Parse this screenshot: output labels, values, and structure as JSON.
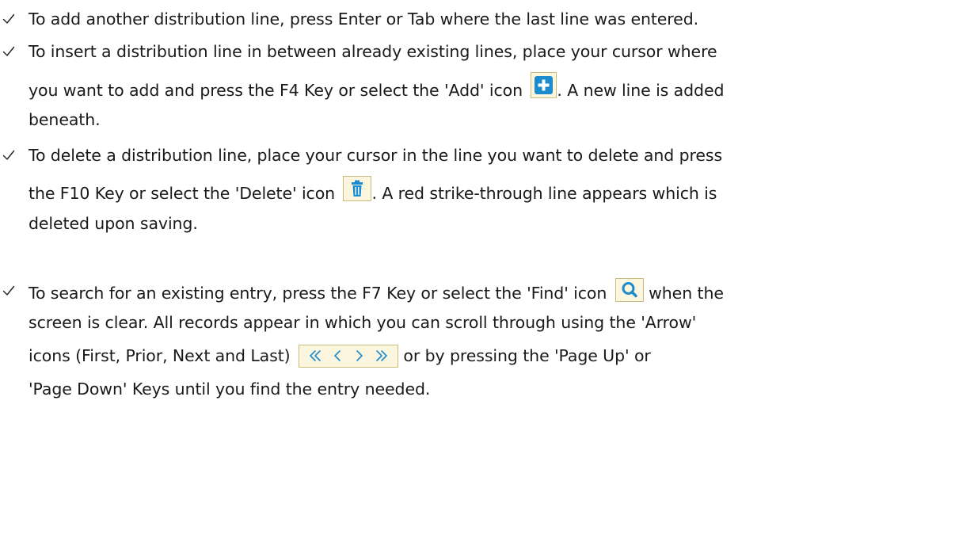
{
  "bullets": [
    {
      "lines": [
        "To add another distribution line, press Enter or Tab where the last line was entered."
      ]
    },
    {
      "lines": [
        "To insert a distribution line in between already existing lines, place your cursor where",
        "you want to add and press the F4 Key or select the 'Add' icon",
        ".  A new line is added",
        "beneath."
      ]
    },
    {
      "lines": [
        "To delete a distribution line, place your cursor in the line you want to delete and press",
        "the F10 Key or select the 'Delete' icon",
        ".  A red strike-through line appears which is",
        "deleted upon saving."
      ]
    },
    {
      "lines": [
        "To search for an existing entry, press the F7 Key or select the 'Find' icon",
        "when the",
        "screen is clear.  All records appear in which you can scroll through using the 'Arrow'",
        "icons (First, Prior, Next and Last)",
        "or by pressing the 'Page Up' or",
        "'Page Down' Keys until you find the entry needed."
      ]
    }
  ],
  "icons": {
    "check": "check-icon",
    "add": "add-icon",
    "delete": "delete-icon",
    "find": "find-icon",
    "nav": [
      "first-icon",
      "prior-icon",
      "next-icon",
      "last-icon"
    ]
  },
  "colors": {
    "icon_blue": "#1c8ccf",
    "icon_bg": "#fbf6dd",
    "icon_border": "#c9bb7c",
    "text": "#1a1a1a"
  }
}
